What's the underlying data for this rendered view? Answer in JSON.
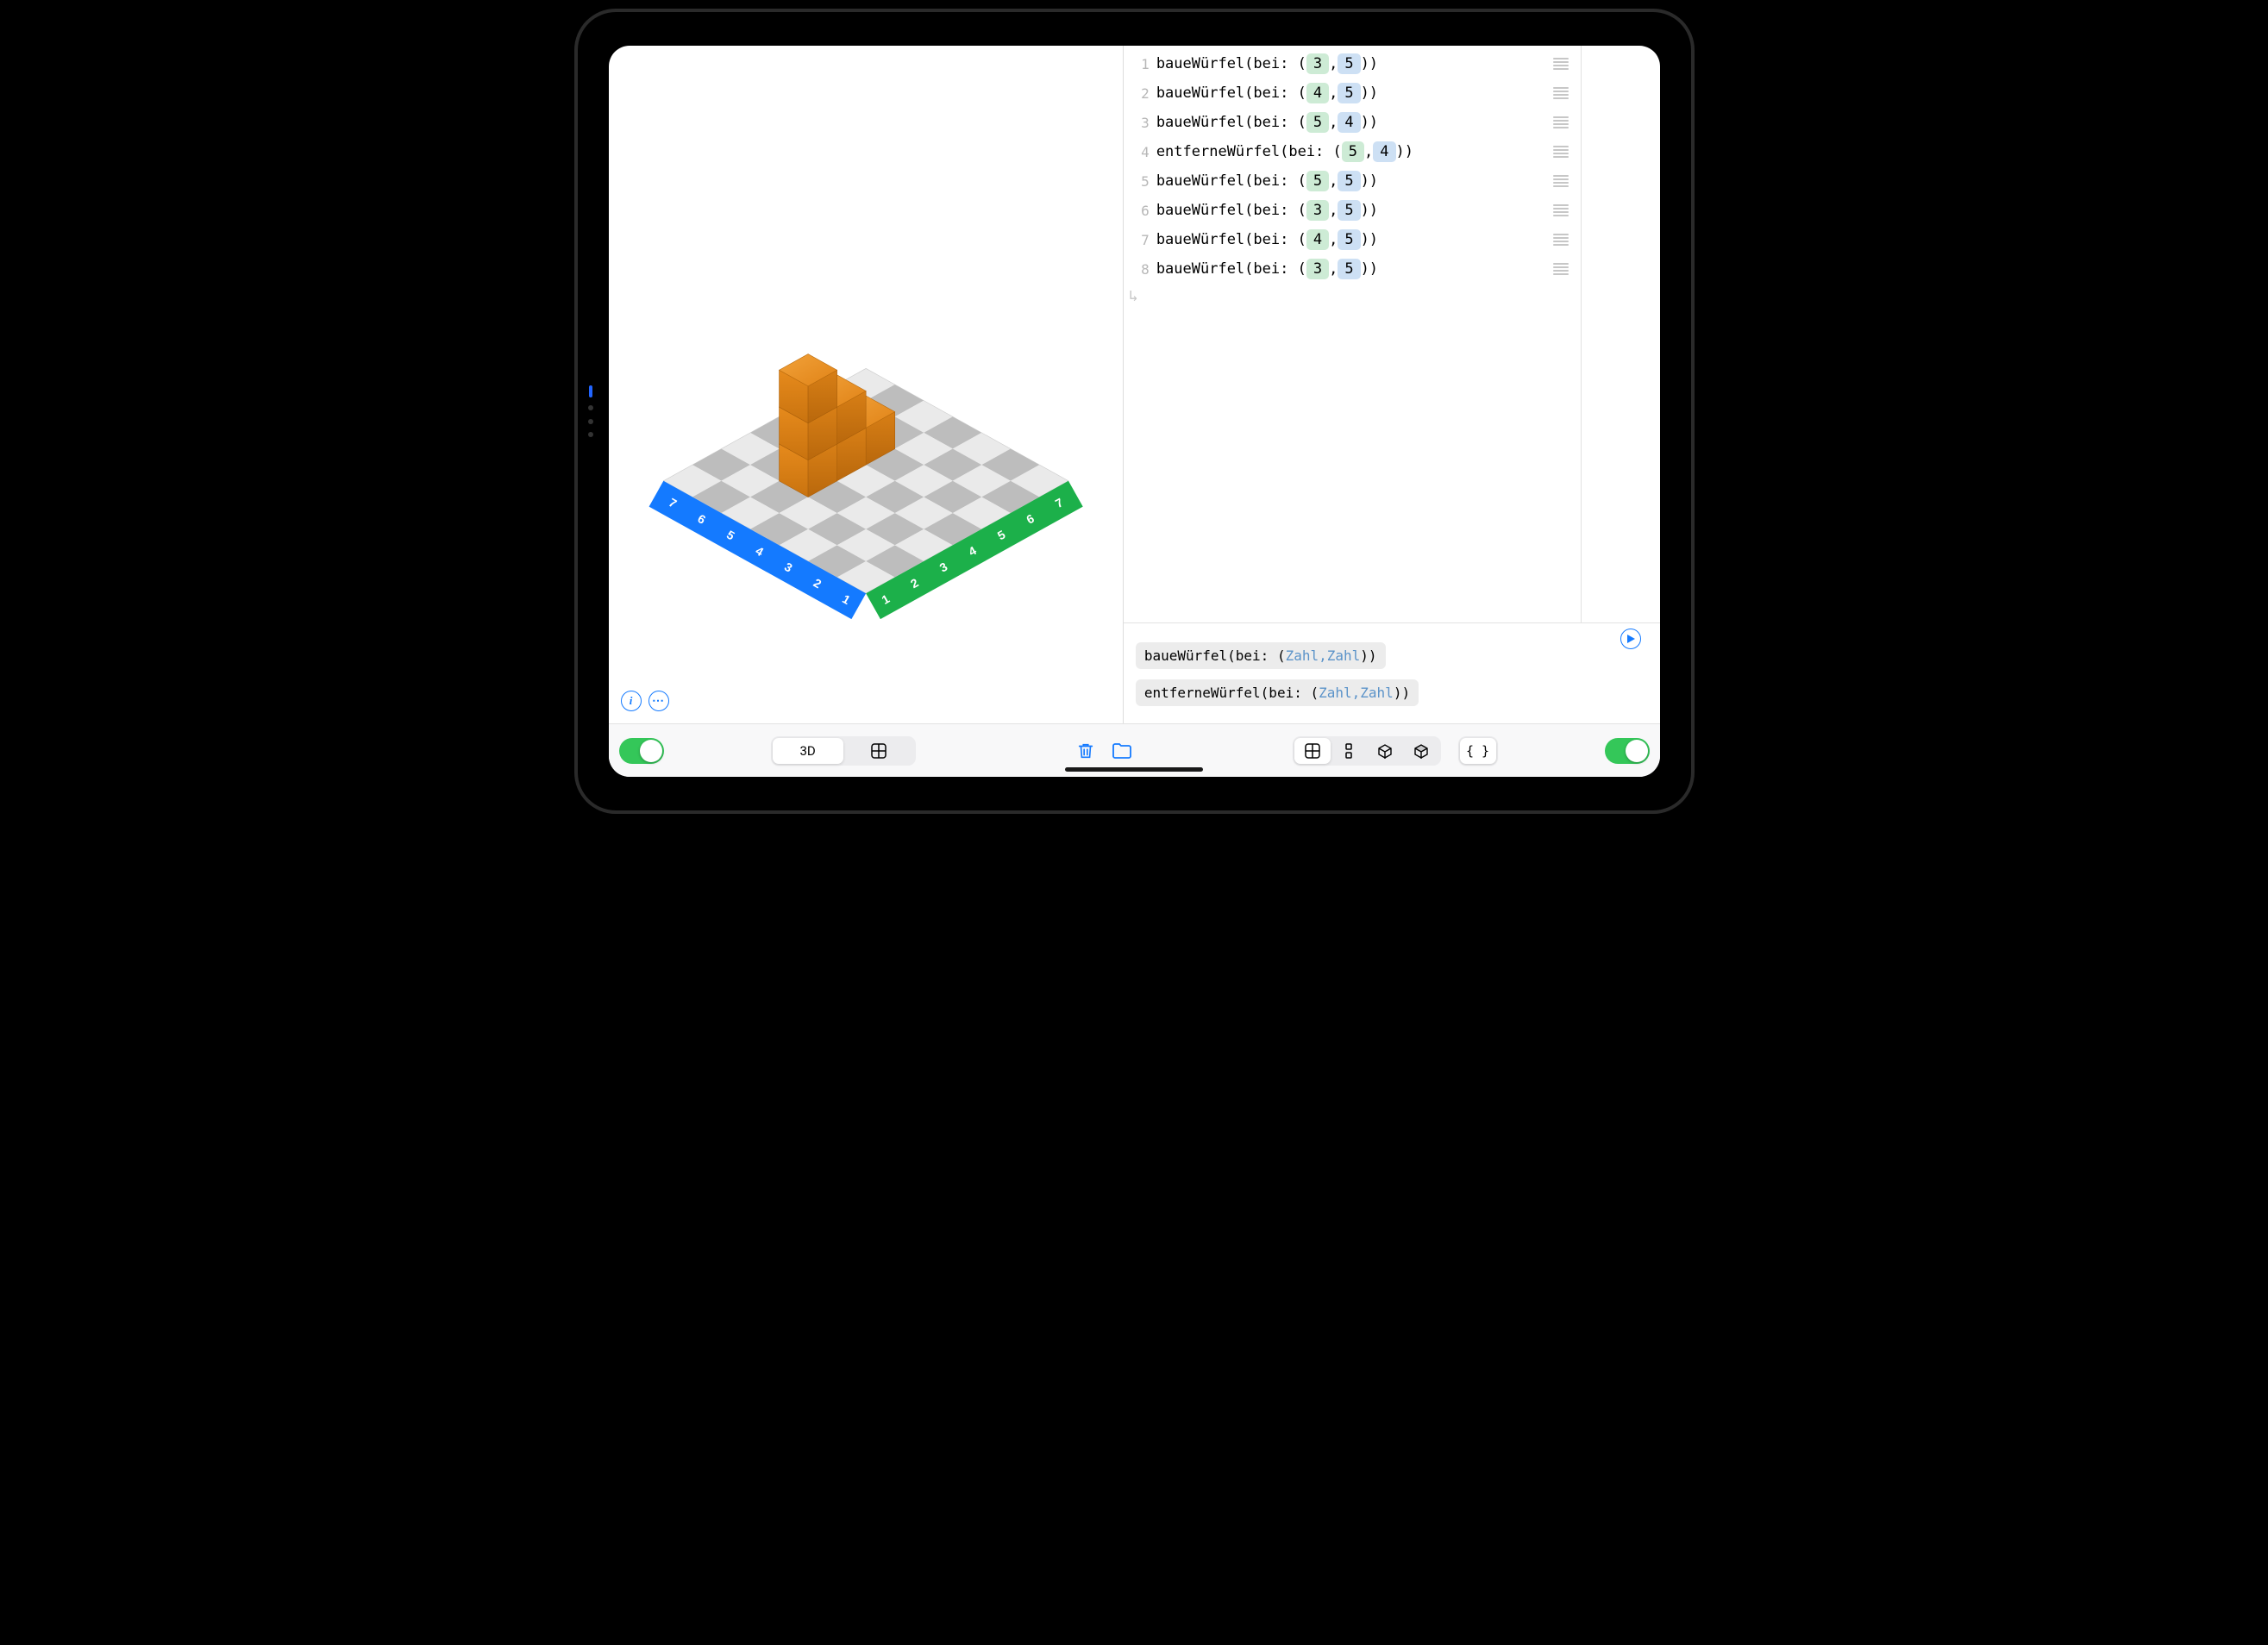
{
  "axes": {
    "labels": [
      "1",
      "2",
      "3",
      "4",
      "5",
      "6",
      "7"
    ]
  },
  "code_lines": [
    {
      "n": "1",
      "fn": "baueWürfel",
      "a": "3",
      "b": "5"
    },
    {
      "n": "2",
      "fn": "baueWürfel",
      "a": "4",
      "b": "5"
    },
    {
      "n": "3",
      "fn": "baueWürfel",
      "a": "5",
      "b": "4"
    },
    {
      "n": "4",
      "fn": "entferneWürfel",
      "a": "5",
      "b": "4"
    },
    {
      "n": "5",
      "fn": "baueWürfel",
      "a": "5",
      "b": "5"
    },
    {
      "n": "6",
      "fn": "baueWürfel",
      "a": "3",
      "b": "5"
    },
    {
      "n": "7",
      "fn": "baueWürfel",
      "a": "4",
      "b": "5"
    },
    {
      "n": "8",
      "fn": "baueWürfel",
      "a": "3",
      "b": "5"
    }
  ],
  "syntax": {
    "bei": "bei:",
    "open": "(",
    "close": ")",
    "pairOpen": "(",
    "pairClose": ")",
    "comma": ","
  },
  "snippets": [
    {
      "pre": "baueWürfel(bei: (",
      "ph": "Zahl,Zahl",
      "post": "))"
    },
    {
      "pre": "entferneWürfel(bei: (",
      "ph": "Zahl,Zahl",
      "post": "))"
    }
  ],
  "view_seg": {
    "label_3d": "3D"
  },
  "icons": {
    "info": "i",
    "more": "⋯",
    "grid": "grid",
    "trash": "trash",
    "folder": "folder",
    "split": "split",
    "cube_out": "cube-outline",
    "cube_fill": "cube-fill",
    "braces": "{ }",
    "play": "play"
  },
  "cubes": [
    {
      "col": 3,
      "row": 5,
      "height": 3
    },
    {
      "col": 4,
      "row": 5,
      "height": 2
    },
    {
      "col": 5,
      "row": 5,
      "height": 1
    }
  ],
  "colors": {
    "blue": "#147aff",
    "green": "#1cb04a",
    "cube": "#e78b1a",
    "cubeDark": "#c06f0e",
    "boardLight": "#ffffff",
    "boardMed": "#e6e6e6",
    "boardDark": "#bdbdbd"
  }
}
